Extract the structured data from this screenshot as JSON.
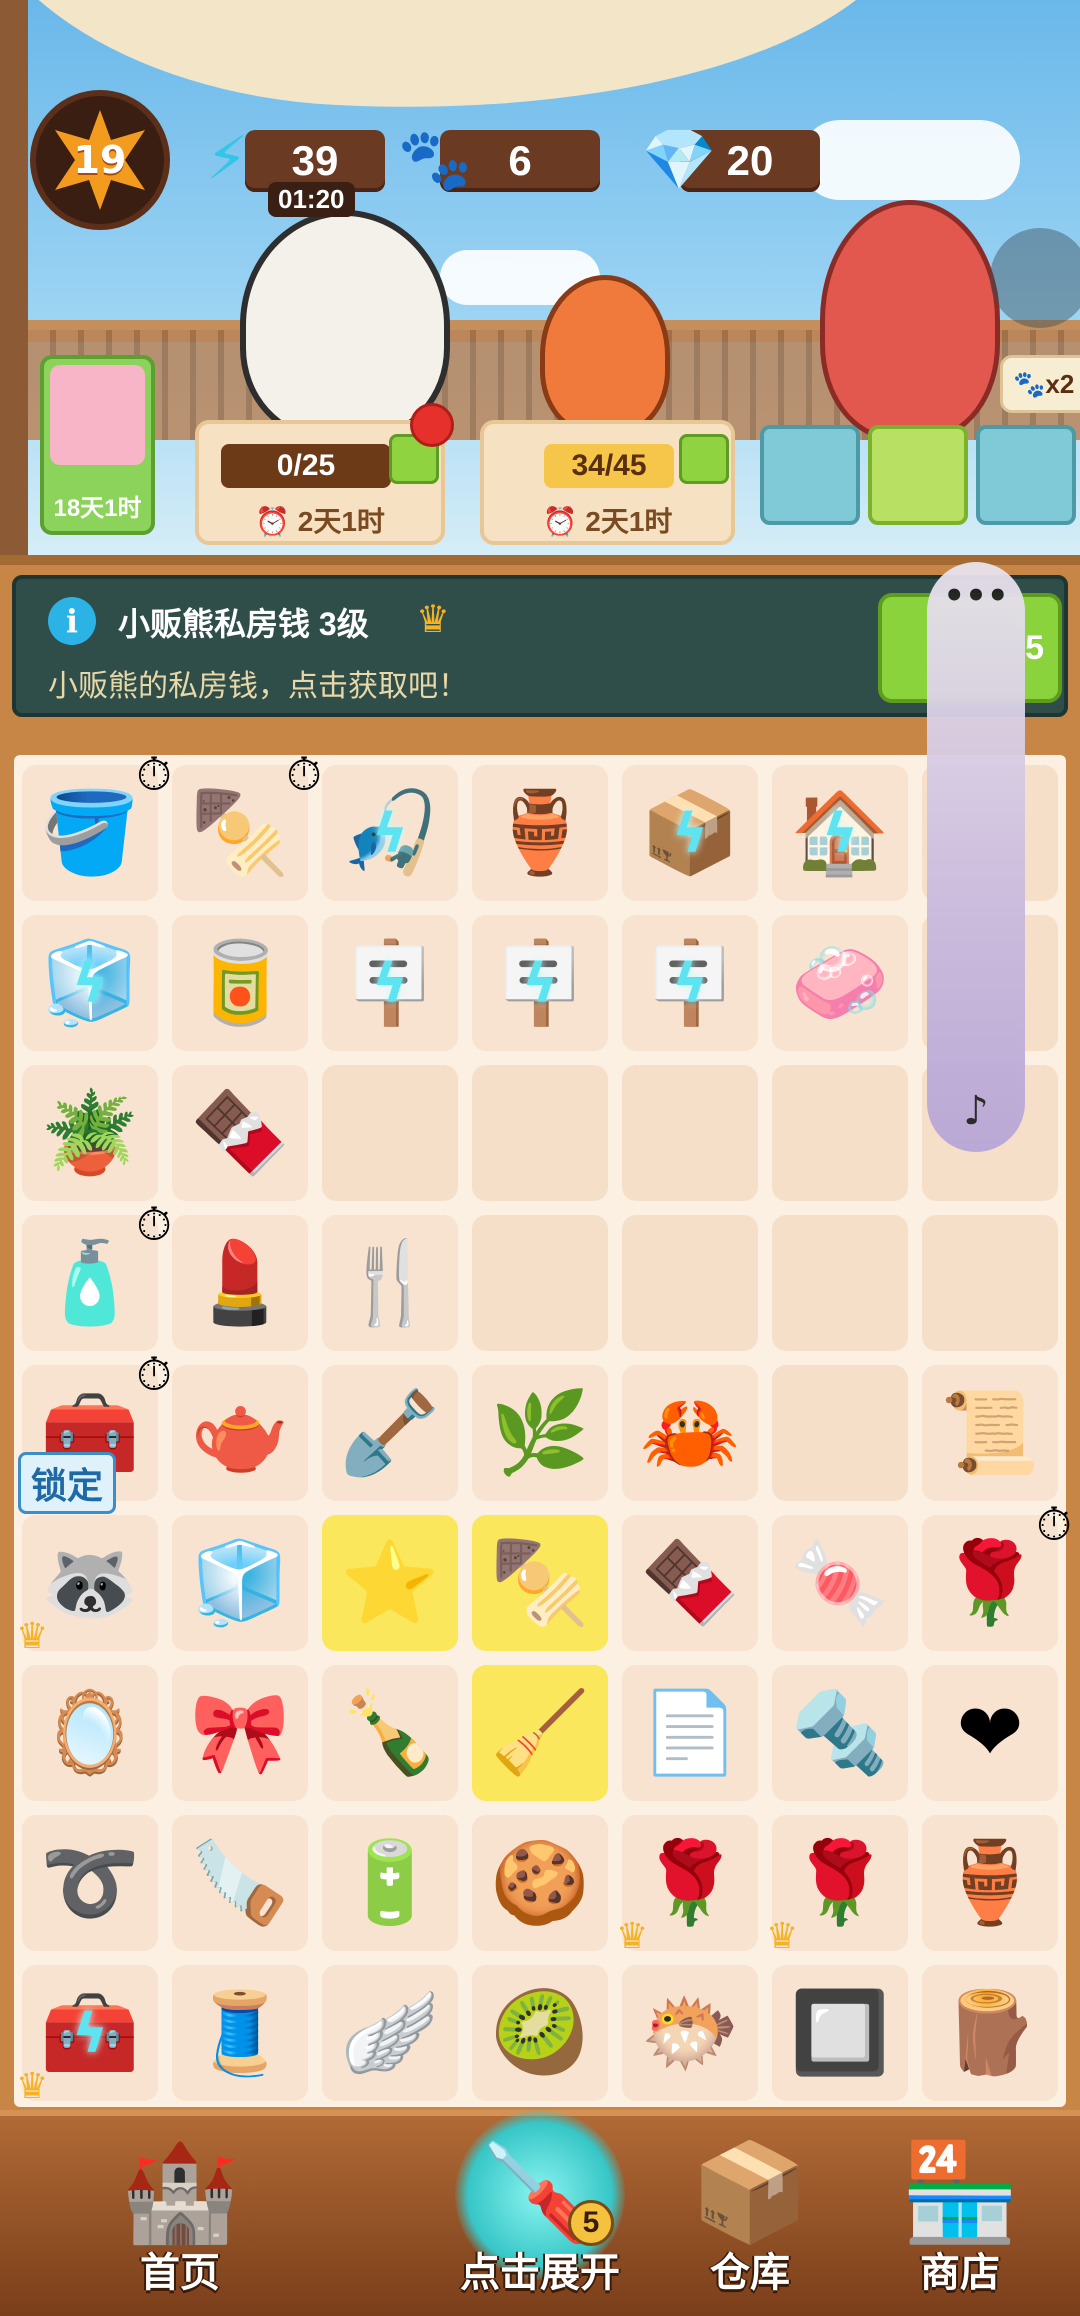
{
  "hud": {
    "level": "19",
    "energy": "39",
    "energy_timer": "01:20",
    "paws": "6",
    "gems": "20",
    "paw_chip": "x2"
  },
  "orders": [
    {
      "progress": "0/25",
      "time": "2天1时"
    },
    {
      "progress": "34/45",
      "time": "2天1时"
    }
  ],
  "side_card": {
    "time": "18天1时"
  },
  "task": {
    "title": "小贩熊私房钱 3级",
    "description": "小贩熊的私房钱，点击获取吧！",
    "button_value": "5"
  },
  "board": {
    "lock_label": "锁定",
    "items": [
      "bucket",
      "grill",
      "fishing-rod",
      "vase",
      "gem-box",
      "house",
      "",
      "vending-machine",
      "paint-buckets",
      "stand",
      "stand-pink",
      "stand-pink-2",
      "soap",
      "",
      "potted-plant",
      "chocolate",
      "",
      "",
      "",
      "",
      "",
      "perfume",
      "lipstick",
      "garden-fork",
      "",
      "",
      "",
      "",
      "treasure-chest",
      "teapot",
      "shovel",
      "skewer-leaf",
      "crab",
      "",
      "scroll",
      "raccoon",
      "ice-cube",
      "starfish",
      "kebab-plate",
      "chocolate-roll",
      "candy",
      "rose-pot",
      "compact",
      "ribbon",
      "bottle-plant",
      "rake",
      "paper-stack",
      "screw",
      "heart-petals",
      "rope",
      "saw",
      "battery",
      "cookies",
      "rose-pot-2",
      "rose-pot-3",
      "green-vase",
      "toolbox",
      "thread-spool",
      "wings",
      "kiwi-bowl",
      "pufferfish",
      "grill-small",
      "wood-planks"
    ]
  },
  "nav": {
    "home": "首页",
    "expand": "点击展开",
    "expand_count": "5",
    "warehouse": "仓库",
    "shop": "商店"
  },
  "overlay": {
    "menu": "•••",
    "music": "♪"
  },
  "colors": {
    "accent": "#8bd33c",
    "gold_cell": "#fbe75b",
    "panel": "#2f4e4a"
  }
}
